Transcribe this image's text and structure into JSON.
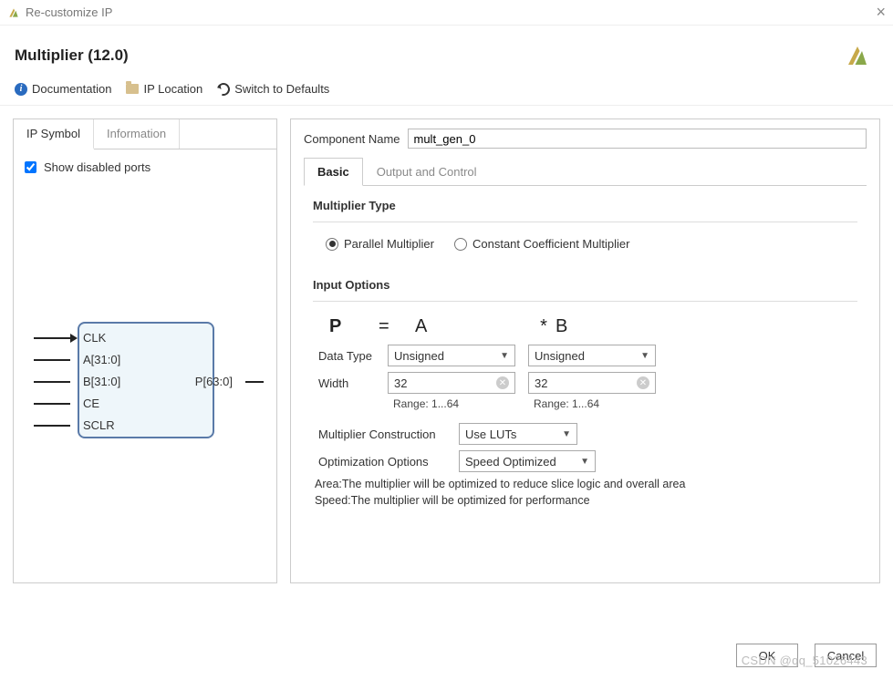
{
  "window": {
    "title": "Re-customize IP",
    "close_glyph": "×"
  },
  "header": {
    "title": "Multiplier (12.0)"
  },
  "toolbar": {
    "documentation": "Documentation",
    "ip_location": "IP Location",
    "switch_defaults": "Switch to Defaults"
  },
  "left": {
    "tabs": {
      "ip_symbol": "IP Symbol",
      "information": "Information"
    },
    "show_disabled": "Show disabled ports",
    "ports_in": [
      "CLK",
      "A[31:0]",
      "B[31:0]",
      "CE",
      "SCLR"
    ],
    "ports_out": [
      "P[63:0]"
    ]
  },
  "right": {
    "component_name_label": "Component Name",
    "component_name_value": "mult_gen_0",
    "tabs": {
      "basic": "Basic",
      "output_control": "Output and Control"
    },
    "mult_type": {
      "title": "Multiplier Type",
      "parallel": "Parallel Multiplier",
      "constant": "Constant Coefficient Multiplier"
    },
    "input_options": {
      "title": "Input Options",
      "eq_p": "P",
      "eq_eq": "=",
      "eq_a": "A",
      "eq_star": "*",
      "eq_b": "B",
      "data_type_label": "Data Type",
      "data_type_a": "Unsigned",
      "data_type_b": "Unsigned",
      "width_label": "Width",
      "width_a": "32",
      "width_b": "32",
      "range_a": "Range: 1...64",
      "range_b": "Range: 1...64",
      "construction_label": "Multiplier Construction",
      "construction_value": "Use LUTs",
      "optimization_label": "Optimization Options",
      "optimization_value": "Speed Optimized",
      "desc_area": "Area:The multiplier will be optimized to reduce slice logic and overall area",
      "desc_speed": "Speed:The multiplier will be optimized for performance"
    }
  },
  "footer": {
    "ok": "OK",
    "cancel": "Cancel"
  },
  "watermark": "CSDN @qq_51026443"
}
